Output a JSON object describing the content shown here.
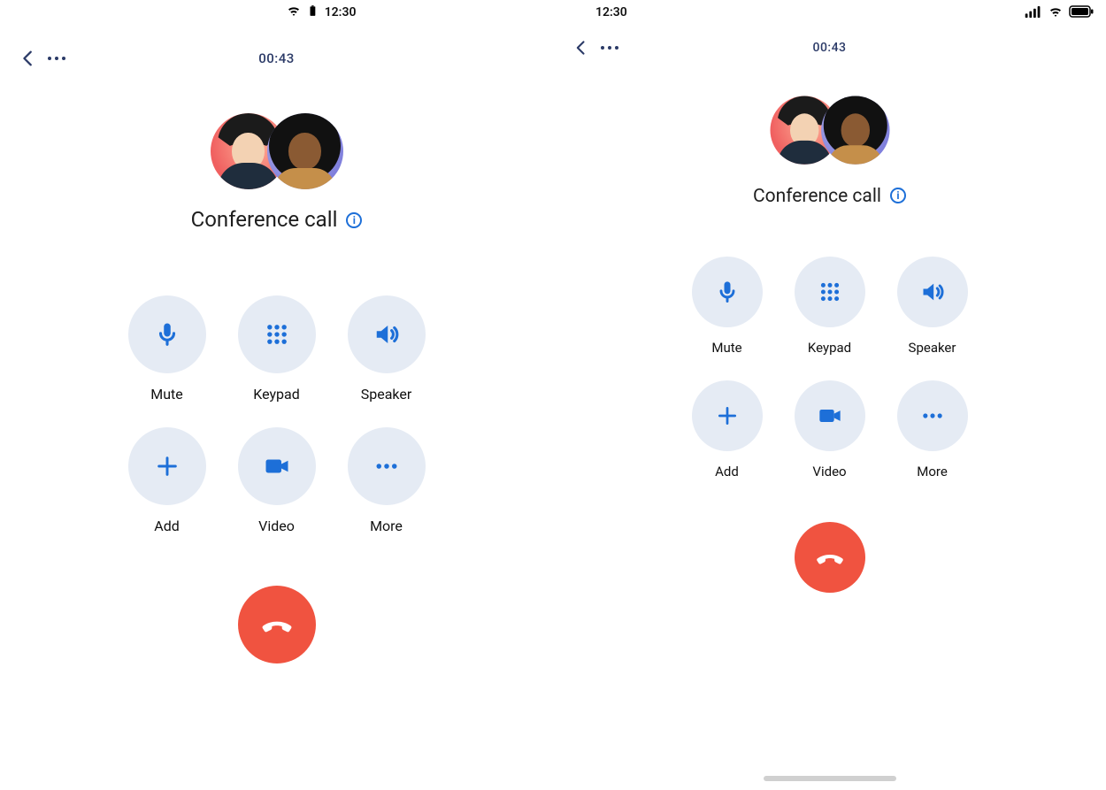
{
  "phones": {
    "left": {
      "platform": "android",
      "status_time": "12:30",
      "call_duration": "00:43",
      "title": "Conference call",
      "buttons": {
        "mute": "Mute",
        "keypad": "Keypad",
        "speaker": "Speaker",
        "add": "Add",
        "video": "Video",
        "more": "More"
      }
    },
    "right": {
      "platform": "ios",
      "status_time": "12:30",
      "call_duration": "00:43",
      "title": "Conference call",
      "buttons": {
        "mute": "Mute",
        "keypad": "Keypad",
        "speaker": "Speaker",
        "add": "Add",
        "video": "Video",
        "more": "More"
      }
    }
  },
  "colors": {
    "accent": "#1d6fd8",
    "button_bg": "#e5ebf4",
    "end_call": "#f05340"
  },
  "icons": {
    "wifi": "wifi-icon",
    "battery": "battery-icon",
    "signal": "signal-icon",
    "back": "chevron-left-icon",
    "overflow": "dots-horizontal-icon",
    "info": "info-circle-icon",
    "mic": "microphone-icon",
    "keypad": "keypad-icon",
    "speaker": "speaker-icon",
    "plus": "plus-icon",
    "video": "video-icon",
    "more": "dots-horizontal-icon",
    "hangup": "phone-hangup-icon"
  }
}
